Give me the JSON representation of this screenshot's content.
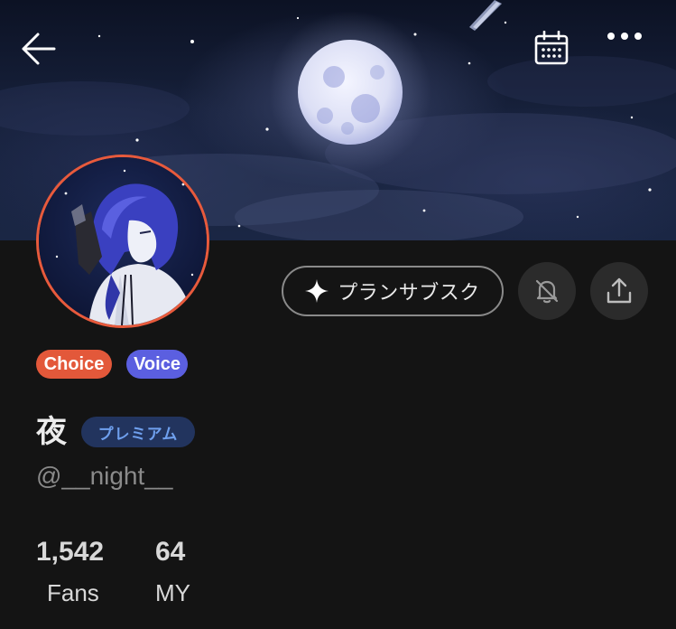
{
  "header": {
    "back_icon": "arrow-left-icon",
    "calendar_icon": "calendar-icon",
    "more_icon": "more-horizontal-icon"
  },
  "profile": {
    "display_name": "夜",
    "premium_label": "プレミアム",
    "handle": "@__night__",
    "badges": [
      {
        "label": "Choice",
        "color": "#e3583a"
      },
      {
        "label": "Voice",
        "color": "#5b5fe0"
      }
    ],
    "avatar_ring_color": "#e85a3c"
  },
  "actions": {
    "plan_subscribe_label": "プランサブスク",
    "plan_icon": "sparkle-icon",
    "bell_icon": "bell-off-icon",
    "share_icon": "share-icon"
  },
  "stats": [
    {
      "value": "1,542",
      "label": "Fans"
    },
    {
      "value": "64",
      "label": "MY"
    }
  ],
  "colors": {
    "background": "#141414",
    "premium_text": "#6fa0ee",
    "premium_bg": "#22345e"
  }
}
